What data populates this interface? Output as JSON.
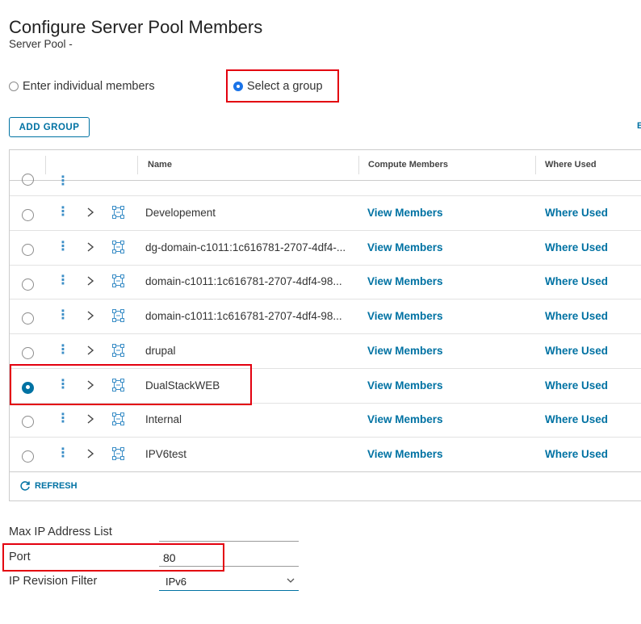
{
  "page": {
    "title": "Configure Server Pool Members",
    "subtitle": "Server Pool -"
  },
  "member_mode": {
    "options": [
      "Enter individual members",
      "Select a group"
    ],
    "selected": "Select a group"
  },
  "toolbar": {
    "add_group_label": "ADD GROUP",
    "edge_label": "E"
  },
  "table": {
    "columns": [
      "Name",
      "Compute Members",
      "Where Used"
    ],
    "rows": [
      {
        "name": "Developement",
        "compute": "View Members",
        "where": "Where Used",
        "selected": false
      },
      {
        "name": "dg-domain-c1011:1c616781-2707-4df4-...",
        "compute": "View Members",
        "where": "Where Used",
        "selected": false
      },
      {
        "name": "domain-c1011:1c616781-2707-4df4-98...",
        "compute": "View Members",
        "where": "Where Used",
        "selected": false
      },
      {
        "name": "domain-c1011:1c616781-2707-4df4-98...",
        "compute": "View Members",
        "where": "Where Used",
        "selected": false
      },
      {
        "name": "drupal",
        "compute": "View Members",
        "where": "Where Used",
        "selected": false
      },
      {
        "name": "DualStackWEB",
        "compute": "View Members",
        "where": "Where Used",
        "selected": true
      },
      {
        "name": "Internal",
        "compute": "View Members",
        "where": "Where Used",
        "selected": false
      },
      {
        "name": "IPV6test",
        "compute": "View Members",
        "where": "Where Used",
        "selected": false
      }
    ],
    "refresh_label": "REFRESH"
  },
  "form": {
    "max_ip_label": "Max IP Address List",
    "max_ip_value": "",
    "port_label": "Port",
    "port_value": "80",
    "ip_filter_label": "IP Revision Filter",
    "ip_filter_value": "IPv6"
  },
  "colors": {
    "accent": "#0072a3",
    "highlight": "#e3000f",
    "selected_radio": "#1a73e8"
  },
  "icons": [
    "kebab-icon",
    "chevron-right-icon",
    "group-icon",
    "refresh-icon",
    "chevron-down-icon"
  ]
}
